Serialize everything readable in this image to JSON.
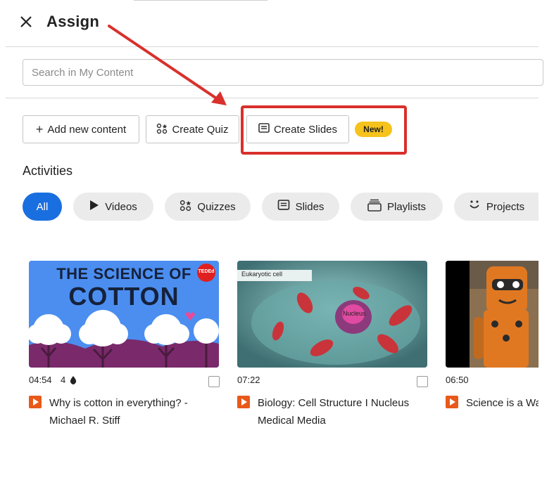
{
  "header": {
    "title": "Assign",
    "close_icon": "close-icon"
  },
  "search": {
    "placeholder": "Search in My Content",
    "value": ""
  },
  "actions": {
    "add_content": "Add new content",
    "create_quiz": "Create Quiz",
    "create_slides": "Create Slides",
    "new_badge": "New!"
  },
  "activities": {
    "heading": "Activities",
    "filters": [
      "All",
      "Videos",
      "Quizzes",
      "Slides",
      "Playlists",
      "Projects"
    ],
    "active_filter": "All"
  },
  "cards": [
    {
      "duration": "04:54",
      "likes": "4",
      "title_line1": "Why is cotton in everything? -",
      "title_line2": "Michael R. Stiff",
      "thumb_text1": "THE SCIENCE OF",
      "thumb_text2": "COTTON",
      "thumb_badge": "TEDEd"
    },
    {
      "duration": "07:22",
      "title_line1": "Biology: Cell Structure I Nucleus",
      "title_line2": "Medical Media",
      "thumb_caption": "Eukaryotic cell",
      "thumb_label": "Nucleus"
    },
    {
      "duration": "06:50",
      "title_line1": "Science is a Wa",
      "title_line2": ""
    }
  ],
  "colors": {
    "accent": "#1a6fe0",
    "badge": "#f6c21c",
    "highlight": "#d9302c",
    "play": "#e8591a"
  }
}
